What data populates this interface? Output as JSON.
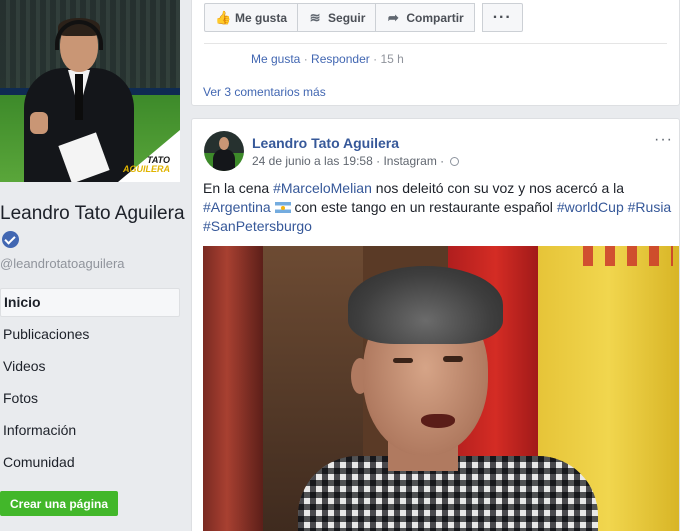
{
  "page": {
    "name": "Leandro Tato Aguilera",
    "handle": "@leandrotatoaguilera",
    "profile_logo_line1": "TATO",
    "profile_logo_line2": "AGUILERA"
  },
  "nav": {
    "items": [
      {
        "label": "Inicio",
        "active": true
      },
      {
        "label": "Publicaciones"
      },
      {
        "label": "Videos"
      },
      {
        "label": "Fotos"
      },
      {
        "label": "Información"
      },
      {
        "label": "Comunidad"
      }
    ],
    "create_page": "Crear una página"
  },
  "previous_post": {
    "actions": {
      "like": "Me gusta",
      "follow": "Seguir",
      "share": "Compartir",
      "more": "···"
    },
    "comment": {
      "like": "Me gusta",
      "reply": "Responder",
      "time": "15 h",
      "sep": "·"
    },
    "more_comments": "Ver 3 comentarios más"
  },
  "post": {
    "author": "Leandro Tato Aguilera",
    "date": "24 de junio a las 19:58",
    "source": "Instagram",
    "sep": "·",
    "menu": "···",
    "text": {
      "part1": "En la cena ",
      "tag1": "#MarceloMelian",
      "part2": " nos deleitó con su voz y nos acercó a la",
      "tag2": "#Argentina",
      "part3": " con este tango en un restaurante español ",
      "tag3": "#worldCup",
      "part4": "  ",
      "tag4": "#Rusia",
      "tag5": "#SanPetersburgo"
    }
  },
  "icons": {
    "like": "thumbs-up-icon",
    "follow": "rss-icon",
    "share": "share-arrow-icon",
    "privacy": "globe-icon",
    "verified": "verified-badge-icon"
  },
  "colors": {
    "link": "#4267b2",
    "author": "#365899",
    "create_button": "#42b72a",
    "verified": "#4267b2"
  }
}
